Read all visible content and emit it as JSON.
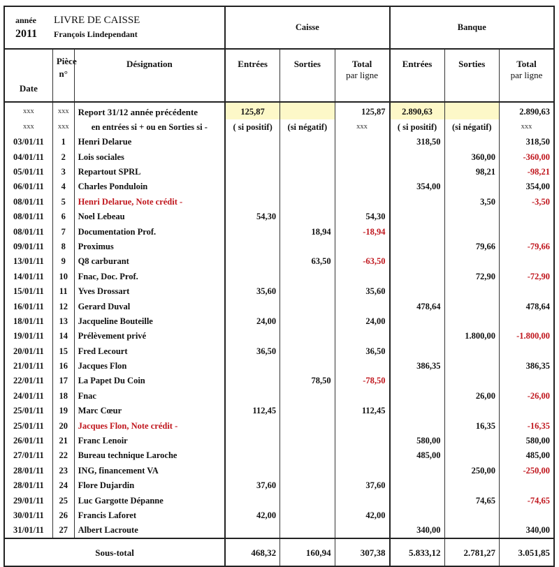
{
  "header": {
    "year_label": "année",
    "year": "2011",
    "title": "LIVRE  DE CAISSE",
    "owner": "François Lindependant",
    "group_caisse": "Caisse",
    "group_banque": "Banque"
  },
  "columns": {
    "date": "Date",
    "piece_line1": "Pièce",
    "piece_line2": "n°",
    "designation": "Désignation",
    "caisse_entrees": "Entrées",
    "caisse_sorties": "Sorties",
    "caisse_total_line1": "Total",
    "caisse_total_line2": "par ligne",
    "banque_entrees": "Entrées",
    "banque_sorties": "Sorties",
    "banque_total_line1": "Total",
    "banque_total_line2": "par ligne"
  },
  "report_row": {
    "date": "xxx",
    "piece": "xxx",
    "designation": "Report 31/12 année précédente",
    "caisse_entrees": "125,87",
    "caisse_sorties": "",
    "caisse_total": "125,87",
    "banque_entrees": "2.890,63",
    "banque_sorties": "",
    "banque_total": "2.890,63"
  },
  "note_row": {
    "date": "xxx",
    "piece": "xxx",
    "designation": "en entrées si +  ou en  Sorties si -",
    "caisse_entrees": "( si positif)",
    "caisse_sorties": "(si négatif)",
    "caisse_total": "xxx",
    "banque_entrees": "( si positif)",
    "banque_sorties": "(si négatif)",
    "banque_total": "xxx"
  },
  "rows": [
    {
      "date": "03/01/11",
      "piece": "1",
      "designation": "Henri Delarue",
      "ce": "",
      "cs": "",
      "ct": "",
      "be": "318,50",
      "bs": "",
      "bt": "318,50"
    },
    {
      "date": "04/01/11",
      "piece": "2",
      "designation": "Lois sociales",
      "ce": "",
      "cs": "",
      "ct": "",
      "be": "",
      "bs": "360,00",
      "bt": "-360,00"
    },
    {
      "date": "05/01/11",
      "piece": "3",
      "designation": "Repartout SPRL",
      "ce": "",
      "cs": "",
      "ct": "",
      "be": "",
      "bs": "98,21",
      "bt": "-98,21"
    },
    {
      "date": "06/01/11",
      "piece": "4",
      "designation": "Charles Ponduloin",
      "ce": "",
      "cs": "",
      "ct": "",
      "be": "354,00",
      "bs": "",
      "bt": "354,00"
    },
    {
      "date": "08/01/11",
      "piece": "5",
      "designation": "Henri Delarue, Note crédit -",
      "red": true,
      "ce": "",
      "cs": "",
      "ct": "",
      "be": "",
      "bs": "3,50",
      "bt": "-3,50"
    },
    {
      "date": "08/01/11",
      "piece": "6",
      "designation": "Noel Lebeau",
      "ce": "54,30",
      "cs": "",
      "ct": "54,30",
      "be": "",
      "bs": "",
      "bt": ""
    },
    {
      "date": "08/01/11",
      "piece": "7",
      "designation": "Documentation Prof.",
      "ce": "",
      "cs": "18,94",
      "ct": "-18,94",
      "be": "",
      "bs": "",
      "bt": ""
    },
    {
      "date": "09/01/11",
      "piece": "8",
      "designation": "Proximus",
      "ce": "",
      "cs": "",
      "ct": "",
      "be": "",
      "bs": "79,66",
      "bt": "-79,66"
    },
    {
      "date": "13/01/11",
      "piece": "9",
      "designation": "Q8 carburant",
      "ce": "",
      "cs": "63,50",
      "ct": "-63,50",
      "be": "",
      "bs": "",
      "bt": ""
    },
    {
      "date": "14/01/11",
      "piece": "10",
      "designation": "Fnac, Doc. Prof.",
      "ce": "",
      "cs": "",
      "ct": "",
      "be": "",
      "bs": "72,90",
      "bt": "-72,90"
    },
    {
      "date": "15/01/11",
      "piece": "11",
      "designation": "Yves Drossart",
      "ce": "35,60",
      "cs": "",
      "ct": "35,60",
      "be": "",
      "bs": "",
      "bt": ""
    },
    {
      "date": "16/01/11",
      "piece": "12",
      "designation": "Gerard Duval",
      "ce": "",
      "cs": "",
      "ct": "",
      "be": "478,64",
      "bs": "",
      "bt": "478,64"
    },
    {
      "date": "18/01/11",
      "piece": "13",
      "designation": "Jacqueline Bouteille",
      "ce": "24,00",
      "cs": "",
      "ct": "24,00",
      "be": "",
      "bs": "",
      "bt": ""
    },
    {
      "date": "19/01/11",
      "piece": "14",
      "designation": "Prélèvement privé",
      "ce": "",
      "cs": "",
      "ct": "",
      "be": "",
      "bs": "1.800,00",
      "bt": "-1.800,00"
    },
    {
      "date": "20/01/11",
      "piece": "15",
      "designation": "Fred Lecourt",
      "ce": "36,50",
      "cs": "",
      "ct": "36,50",
      "be": "",
      "bs": "",
      "bt": ""
    },
    {
      "date": "21/01/11",
      "piece": "16",
      "designation": "Jacques Flon",
      "ce": "",
      "cs": "",
      "ct": "",
      "be": "386,35",
      "bs": "",
      "bt": "386,35"
    },
    {
      "date": "22/01/11",
      "piece": "17",
      "designation": "La Papet Du Coin",
      "ce": "",
      "cs": "78,50",
      "ct": "-78,50",
      "be": "",
      "bs": "",
      "bt": ""
    },
    {
      "date": "24/01/11",
      "piece": "18",
      "designation": "Fnac",
      "ce": "",
      "cs": "",
      "ct": "",
      "be": "",
      "bs": "26,00",
      "bt": "-26,00"
    },
    {
      "date": "25/01/11",
      "piece": "19",
      "designation": "Marc Cœur",
      "ce": "112,45",
      "cs": "",
      "ct": "112,45",
      "be": "",
      "bs": "",
      "bt": ""
    },
    {
      "date": "25/01/11",
      "piece": "20",
      "designation": "Jacques Flon, Note crédit -",
      "red": true,
      "ce": "",
      "cs": "",
      "ct": "",
      "be": "",
      "bs": "16,35",
      "bt": "-16,35"
    },
    {
      "date": "26/01/11",
      "piece": "21",
      "designation": "Franc Lenoir",
      "ce": "",
      "cs": "",
      "ct": "",
      "be": "580,00",
      "bs": "",
      "bt": "580,00"
    },
    {
      "date": "27/01/11",
      "piece": "22",
      "designation": "Bureau technique Laroche",
      "ce": "",
      "cs": "",
      "ct": "",
      "be": "485,00",
      "bs": "",
      "bt": "485,00"
    },
    {
      "date": "28/01/11",
      "piece": "23",
      "designation": "ING, financement VA",
      "ce": "",
      "cs": "",
      "ct": "",
      "be": "",
      "bs": "250,00",
      "bt": "-250,00"
    },
    {
      "date": "28/01/11",
      "piece": "24",
      "designation": "Flore Dujardin",
      "ce": "37,60",
      "cs": "",
      "ct": "37,60",
      "be": "",
      "bs": "",
      "bt": ""
    },
    {
      "date": "29/01/11",
      "piece": "25",
      "designation": "Luc Gargotte Dépanne",
      "ce": "",
      "cs": "",
      "ct": "",
      "be": "",
      "bs": "74,65",
      "bt": "-74,65"
    },
    {
      "date": "30/01/11",
      "piece": "26",
      "designation": "Francis Laforet",
      "ce": "42,00",
      "cs": "",
      "ct": "42,00",
      "be": "",
      "bs": "",
      "bt": ""
    },
    {
      "date": "31/01/11",
      "piece": "27",
      "designation": "Albert Lacroute",
      "ce": "",
      "cs": "",
      "ct": "",
      "be": "340,00",
      "bs": "",
      "bt": "340,00"
    }
  ],
  "subtotal": {
    "label": "Sous-total",
    "caisse_entrees": "468,32",
    "caisse_sorties": "160,94",
    "caisse_total": "307,38",
    "banque_entrees": "5.833,12",
    "banque_sorties": "2.781,27",
    "banque_total": "3.051,85"
  },
  "colors": {
    "negative": "#c0161d",
    "report_highlight": "#fdf8c8"
  }
}
